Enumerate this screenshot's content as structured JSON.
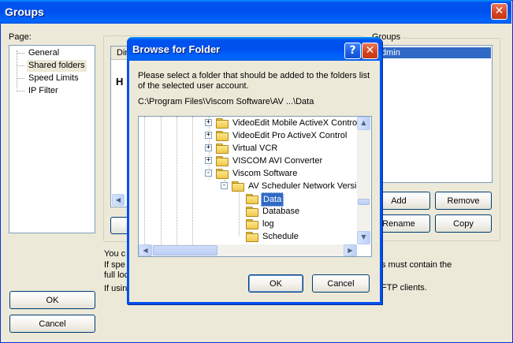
{
  "window": {
    "title": "Groups"
  },
  "page_section": {
    "label": "Page:",
    "items": [
      {
        "label": "General",
        "selected": false
      },
      {
        "label": "Shared folders",
        "selected": true
      },
      {
        "label": "Speed Limits",
        "selected": false
      },
      {
        "label": "IP Filter",
        "selected": false
      }
    ]
  },
  "main": {
    "list_header_partial": "Dir",
    "heading_partial": "H",
    "info_line1_partial": "You c",
    "info_line2_partial": "If spe",
    "info_line3_partial": "full loc",
    "info_line4_partial": "If usin",
    "info_right1": "s must contain the",
    "info_right2": "FTP clients."
  },
  "groups": {
    "label": "Groups",
    "selected_item_partial": "dmin",
    "add_label": "Add",
    "remove_label": "Remove",
    "rename_label": "Rename",
    "copy_label": "Copy"
  },
  "footer": {
    "ok_label": "OK",
    "cancel_label": "Cancel"
  },
  "dialog": {
    "title": "Browse for Folder",
    "help_glyph": "?",
    "description": "Please select a folder that should be added to the folders list of the selected user account.",
    "path": "C:\\Program Files\\Viscom Software\\AV ...\\Data",
    "tree": [
      {
        "label": "VideoEdit Mobile ActiveX Control",
        "expander": "+",
        "level": 0
      },
      {
        "label": "VideoEdit Pro ActiveX Control",
        "expander": "+",
        "level": 0
      },
      {
        "label": "Virtual VCR",
        "expander": "+",
        "level": 0
      },
      {
        "label": "VISCOM AVI Converter",
        "expander": "+",
        "level": 0
      },
      {
        "label": "Viscom Software",
        "expander": "-",
        "level": 0
      },
      {
        "label": "AV Scheduler Network Version",
        "expander": "-",
        "level": 1
      },
      {
        "label": "Data",
        "expander": "",
        "level": 2,
        "selected": true
      },
      {
        "label": "Database",
        "expander": "",
        "level": 2
      },
      {
        "label": "log",
        "expander": "",
        "level": 2
      },
      {
        "label": "Schedule",
        "expander": "",
        "level": 2
      }
    ],
    "ok_label": "OK",
    "cancel_label": "Cancel"
  },
  "icons": [
    "close-icon",
    "help-icon",
    "folder-icon",
    "scroll-up-icon",
    "scroll-down-icon",
    "scroll-left-icon",
    "scroll-right-icon"
  ]
}
